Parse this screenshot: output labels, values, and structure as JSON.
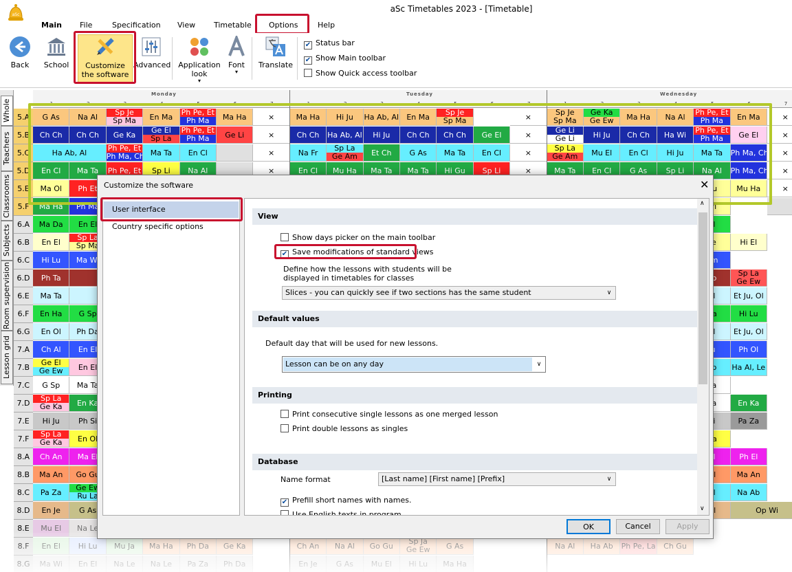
{
  "app": {
    "title": "aSc Timetables 2023 - [Timetable]",
    "logo_text": "aSc"
  },
  "menu": [
    "Main",
    "File",
    "Specification",
    "View",
    "Timetable",
    "Options",
    "Help"
  ],
  "ribbon": {
    "buttons": [
      {
        "label": "Back",
        "icon": "back-arrow-icon"
      },
      {
        "label": "School",
        "icon": "school-icon"
      },
      {
        "label": "Customize the software",
        "icon": "pencil-ruler-icon"
      },
      {
        "label": "Advanced",
        "icon": "sliders-icon"
      },
      {
        "label": "Application look",
        "icon": "palette-icon"
      },
      {
        "label": "Font",
        "icon": "font-a-icon"
      },
      {
        "label": "Translate",
        "icon": "translate-icon"
      }
    ],
    "checks": [
      {
        "label": "Status bar",
        "checked": true
      },
      {
        "label": "Show Main toolbar",
        "checked": true
      },
      {
        "label": "Show Quick access toolbar",
        "checked": false
      }
    ]
  },
  "side_tabs": [
    "Whole",
    "Teachers",
    "Classrooms",
    "Subjects",
    "Room supervision",
    "Lesson grid"
  ],
  "days": [
    "Monday",
    "Tuesday",
    "Wednesday"
  ],
  "periods": [
    "1",
    "2",
    "3",
    "4",
    "5",
    "6",
    "7"
  ],
  "rows": [
    "5.A",
    "5.B",
    "5.C",
    "5.D",
    "5.E",
    "5.F",
    "6.A",
    "6.B",
    "6.C",
    "6.D",
    "6.E",
    "6.F",
    "6.G",
    "7.A",
    "7.B",
    "7.C",
    "7.D",
    "7.E",
    "7.F",
    "8.A",
    "8.B",
    "8.C",
    "8.D",
    "8.E",
    "8.F",
    "8.G"
  ],
  "cells": [
    {
      "r": 0,
      "c": 0,
      "t": "G As",
      "bg": "#fbc77e"
    },
    {
      "r": 0,
      "c": 1,
      "t": "Na Al",
      "bg": "#fbc77e"
    },
    {
      "r": 0,
      "c": 2,
      "t": "Sp Je",
      "t2": "Sp Ma",
      "bg": "#ff2222",
      "bg2": "#ffc8e0"
    },
    {
      "r": 0,
      "c": 3,
      "t": "En Ma",
      "bg": "#fbc77e"
    },
    {
      "r": 0,
      "c": 4,
      "t": "Ph Pe, Et",
      "t2": "Ph Ma",
      "bg": "#ff2222",
      "bg2": "#2233dd"
    },
    {
      "r": 0,
      "c": 5,
      "t": "Ma Ha",
      "bg": "#fbc77e"
    },
    {
      "r": 0,
      "c": 6,
      "t": "×",
      "bg": "#ffffff"
    },
    {
      "r": 0,
      "c": 7,
      "t": "Ma Ha",
      "bg": "#fbc77e"
    },
    {
      "r": 0,
      "c": 8,
      "t": "Hi Ju",
      "bg": "#fbc77e"
    },
    {
      "r": 0,
      "c": 9,
      "t": "Ha Ab, Al",
      "bg": "#fbc77e"
    },
    {
      "r": 0,
      "c": 10,
      "t": "En Ma",
      "bg": "#fbc77e"
    },
    {
      "r": 0,
      "c": 11,
      "t": "Sp Je",
      "t2": "Sp Ma",
      "bg": "#ff2222",
      "bg2": "#fbc77e"
    },
    {
      "r": 0,
      "c": 13,
      "t": "×",
      "bg": "#ffffff"
    },
    {
      "r": 0,
      "c": 14,
      "t": "Sp Je",
      "t2": "Sp Ma",
      "bg": "#fbc77e",
      "bg2": "#fbc77e"
    },
    {
      "r": 0,
      "c": 15,
      "t": "Ge Ka",
      "t2": "Ge Ew",
      "bg": "#22dd44",
      "bg2": "#fbc77e"
    },
    {
      "r": 0,
      "c": 16,
      "t": "Ma Ha",
      "bg": "#fbc77e"
    },
    {
      "r": 0,
      "c": 17,
      "t": "Na Al",
      "bg": "#fbc77e"
    },
    {
      "r": 0,
      "c": 18,
      "t": "Ph Pe, Et",
      "t2": "Ph Ma",
      "bg": "#ff2222",
      "bg2": "#2233dd"
    },
    {
      "r": 0,
      "c": 19,
      "t": "En Ma",
      "bg": "#fbc77e"
    },
    {
      "r": 0,
      "c": 20,
      "t": "×",
      "bg": "#ffffff"
    },
    {
      "r": 1,
      "c": 0,
      "t": "Ch Ch",
      "bg": "#1a2aa8"
    },
    {
      "r": 1,
      "c": 1,
      "t": "Ch Ch",
      "bg": "#1a2aa8"
    },
    {
      "r": 1,
      "c": 2,
      "t": "Ge Ka",
      "bg": "#1a2aa8"
    },
    {
      "r": 1,
      "c": 3,
      "t": "Ge El",
      "t2": "Sp La",
      "bg": "#1a2aa8",
      "bg2": "#ff4444"
    },
    {
      "r": 1,
      "c": 4,
      "t": "Ph Pe, Et",
      "t2": "Ph Ma",
      "bg": "#ff2222",
      "bg2": "#2233dd"
    },
    {
      "r": 1,
      "c": 5,
      "t": "Ge Li",
      "bg": "#ff4444"
    },
    {
      "r": 1,
      "c": 6,
      "t": "×",
      "bg": "#ffffff"
    },
    {
      "r": 1,
      "c": 7,
      "t": "Ch Ch",
      "bg": "#1a2aa8"
    },
    {
      "r": 1,
      "c": 8,
      "t": "Ha Ab, Al",
      "bg": "#1a2aa8"
    },
    {
      "r": 1,
      "c": 9,
      "t": "Hi Ju",
      "bg": "#1a2aa8"
    },
    {
      "r": 1,
      "c": 10,
      "t": "Ch Ch",
      "bg": "#1a2aa8"
    },
    {
      "r": 1,
      "c": 11,
      "t": "Ch Ch",
      "bg": "#1a2aa8"
    },
    {
      "r": 1,
      "c": 12,
      "t": "Ge El",
      "bg": "#22aa44"
    },
    {
      "r": 1,
      "c": 13,
      "t": "×",
      "bg": "#ffffff"
    },
    {
      "r": 1,
      "c": 14,
      "t": "Ge Li",
      "t2": "Ge Li",
      "bg": "#1a2aa8",
      "bg2": "#ffffff"
    },
    {
      "r": 1,
      "c": 15,
      "t": "Hi Ju",
      "bg": "#1a2aa8"
    },
    {
      "r": 1,
      "c": 16,
      "t": "Ch Ch",
      "bg": "#1a2aa8"
    },
    {
      "r": 1,
      "c": 17,
      "t": "Ha Wi",
      "bg": "#1a2aa8"
    },
    {
      "r": 1,
      "c": 18,
      "t": "Ph Pe, Et",
      "t2": "Ph Ma",
      "bg": "#ff2222",
      "bg2": "#2233dd"
    },
    {
      "r": 1,
      "c": 19,
      "t": "Ge El",
      "bg": "#ffd0f0"
    },
    {
      "r": 1,
      "c": 20,
      "t": "×",
      "bg": "#ffffff"
    },
    {
      "r": 2,
      "c": 0,
      "t": "Ha Ab, Al",
      "bg": "#66eeff",
      "w": 2
    },
    {
      "r": 2,
      "c": 2,
      "t": "Ph Pe, Et",
      "t2": "Ph Ma, Ch",
      "bg": "#ff2222",
      "bg2": "#2233dd"
    },
    {
      "r": 2,
      "c": 3,
      "t": "Ma Ta",
      "bg": "#66eeff"
    },
    {
      "r": 2,
      "c": 4,
      "t": "En Cl",
      "bg": "#66eeff"
    },
    {
      "r": 2,
      "c": 5,
      "t": "",
      "bg": "#e0e0e0"
    },
    {
      "r": 2,
      "c": 6,
      "t": "×",
      "bg": "#ffffff"
    },
    {
      "r": 2,
      "c": 7,
      "t": "Na Fr",
      "bg": "#66eeff"
    },
    {
      "r": 2,
      "c": 8,
      "t": "Sp La",
      "t2": "Ge Am",
      "bg": "#66eeff",
      "bg2": "#ff4444"
    },
    {
      "r": 2,
      "c": 9,
      "t": "Et Ch",
      "bg": "#22aa44"
    },
    {
      "r": 2,
      "c": 10,
      "t": "G As",
      "bg": "#66eeff"
    },
    {
      "r": 2,
      "c": 11,
      "t": "Ma Ta",
      "bg": "#66eeff"
    },
    {
      "r": 2,
      "c": 12,
      "t": "En Cl",
      "bg": "#66eeff"
    },
    {
      "r": 2,
      "c": 13,
      "t": "×",
      "bg": "#ffffff"
    },
    {
      "r": 2,
      "c": 14,
      "t": "Sp La",
      "t2": "Ge Am",
      "bg": "#ffff44",
      "bg2": "#ff4444"
    },
    {
      "r": 2,
      "c": 15,
      "t": "Mu El",
      "bg": "#66eeff"
    },
    {
      "r": 2,
      "c": 16,
      "t": "En Cl",
      "bg": "#66eeff"
    },
    {
      "r": 2,
      "c": 17,
      "t": "Hi Ju",
      "bg": "#66eeff"
    },
    {
      "r": 2,
      "c": 18,
      "t": "Ma Ta",
      "bg": "#66eeff"
    },
    {
      "r": 2,
      "c": 19,
      "t": "Ph Ma, Ch",
      "bg": "#2233dd"
    },
    {
      "r": 2,
      "c": 20,
      "t": "×",
      "bg": "#ffffff"
    },
    {
      "r": 3,
      "c": 0,
      "t": "En Cl",
      "bg": "#22aa44"
    },
    {
      "r": 3,
      "c": 1,
      "t": "Ma Ta",
      "bg": "#22aa44"
    },
    {
      "r": 3,
      "c": 2,
      "t": "Ph Pe, Et",
      "bg": "#ff2222"
    },
    {
      "r": 3,
      "c": 3,
      "t": "Sp Li",
      "bg": "#ffff44"
    },
    {
      "r": 3,
      "c": 4,
      "t": "Na Al",
      "bg": "#22aa44"
    },
    {
      "r": 3,
      "c": 5,
      "t": "",
      "bg": "#e0e0e0"
    },
    {
      "r": 3,
      "c": 6,
      "t": "×",
      "bg": "#ffffff"
    },
    {
      "r": 3,
      "c": 7,
      "t": "En Cl",
      "bg": "#22aa44"
    },
    {
      "r": 3,
      "c": 8,
      "t": "Mu Ha",
      "bg": "#22aa44"
    },
    {
      "r": 3,
      "c": 9,
      "t": "Ma Ta",
      "bg": "#22aa44"
    },
    {
      "r": 3,
      "c": 10,
      "t": "Ma Ta",
      "bg": "#22aa44"
    },
    {
      "r": 3,
      "c": 11,
      "t": "Hi Gu",
      "bg": "#22aa44"
    },
    {
      "r": 3,
      "c": 12,
      "t": "Sp Li",
      "bg": "#ff2222"
    },
    {
      "r": 3,
      "c": 13,
      "t": "×",
      "bg": "#ffffff"
    },
    {
      "r": 3,
      "c": 14,
      "t": "Ma Ta",
      "bg": "#22aa44"
    },
    {
      "r": 3,
      "c": 15,
      "t": "En Cl",
      "bg": "#22aa44"
    },
    {
      "r": 3,
      "c": 16,
      "t": "G As",
      "bg": "#22aa44"
    },
    {
      "r": 3,
      "c": 17,
      "t": "Sp Li",
      "bg": "#22aa44"
    },
    {
      "r": 3,
      "c": 18,
      "t": "Na Al",
      "bg": "#22aa44"
    },
    {
      "r": 3,
      "c": 19,
      "t": "Ph Ma, Ch",
      "bg": "#2233dd"
    },
    {
      "r": 3,
      "c": 20,
      "t": "×",
      "bg": "#ffffff"
    },
    {
      "r": 4,
      "c": 0,
      "t": "Ma Ol",
      "bg": "#ffff99"
    },
    {
      "r": 4,
      "c": 1,
      "t": "Ph Et",
      "bg": "#ff2222"
    },
    {
      "r": 4,
      "c": 18,
      "t": "Gu",
      "bg": "#ffff99"
    },
    {
      "r": 4,
      "c": 19,
      "t": "Mu Ha",
      "bg": "#ffff99"
    },
    {
      "r": 4,
      "c": 20,
      "t": "×",
      "bg": "#ffffff"
    },
    {
      "r": 5,
      "c": 0,
      "t": "Ma Ha",
      "bg": "#22aa44"
    },
    {
      "r": 5,
      "c": 1,
      "t": "Ph Ma",
      "bg": "#2233dd"
    },
    {
      "r": 5,
      "c": 18,
      "t": "Wi",
      "bg": "#ffff99"
    },
    {
      "r": 5,
      "c": 20,
      "t": "",
      "bg": "#e0e0e0"
    },
    {
      "r": 6,
      "c": 0,
      "t": "Ma Da",
      "bg": "#22dd44"
    },
    {
      "r": 6,
      "c": 1,
      "t": "En El",
      "bg": "#22dd44"
    },
    {
      "r": 6,
      "c": 18,
      "t": "El",
      "bg": "#22dd44"
    },
    {
      "r": 7,
      "c": 0,
      "t": "En El",
      "bg": "#ffffcc"
    },
    {
      "r": 7,
      "c": 1,
      "t": "Sp La",
      "t2": "Sp Ma",
      "bg": "#ff2222",
      "bg2": "#ffff99"
    },
    {
      "r": 7,
      "c": 18,
      "t": "Le",
      "bg": "#ffff99"
    },
    {
      "r": 7,
      "c": 19,
      "t": "Hi El",
      "bg": "#ffffcc"
    },
    {
      "r": 8,
      "c": 0,
      "t": "Hi Lu",
      "bg": "#3355ff"
    },
    {
      "r": 8,
      "c": 1,
      "t": "Ma Wi",
      "bg": "#3355ff"
    },
    {
      "r": 8,
      "c": 18,
      "t": "Am",
      "bg": "#3355ff"
    },
    {
      "r": 9,
      "c": 0,
      "t": "Ph Ta",
      "bg": "#a0322d"
    },
    {
      "r": 9,
      "c": 1,
      "t": "",
      "bg": "#a0322d"
    },
    {
      "r": 9,
      "c": 18,
      "t": "Sp",
      "bg": "#a0322d"
    },
    {
      "r": 9,
      "c": 19,
      "t": "Sp La",
      "t2": "Ge Ew",
      "bg": "#ff5555",
      "bg2": "#ff5555"
    },
    {
      "r": 10,
      "c": 0,
      "t": "Ma Ta",
      "bg": "#ccf5ff"
    },
    {
      "r": 10,
      "c": 1,
      "t": "",
      "bg": "#ccf5ff"
    },
    {
      "r": 10,
      "c": 18,
      "t": "El",
      "bg": "#ccf5ff"
    },
    {
      "r": 10,
      "c": 19,
      "t": "Et Ju, Ol",
      "bg": "#ccf5ff"
    },
    {
      "r": 11,
      "c": 0,
      "t": "En Ha",
      "bg": "#22dd44"
    },
    {
      "r": 11,
      "c": 1,
      "t": "G Sp",
      "bg": "#22dd44"
    },
    {
      "r": 11,
      "c": 18,
      "t": "Ha",
      "bg": "#22dd44"
    },
    {
      "r": 11,
      "c": 19,
      "t": "Hi Lu",
      "bg": "#22dd44"
    },
    {
      "r": 12,
      "c": 0,
      "t": "En Ol",
      "bg": "#ccf5ff"
    },
    {
      "r": 12,
      "c": 1,
      "t": "Ph Da",
      "bg": "#ccf5ff"
    },
    {
      "r": 12,
      "c": 18,
      "t": "El",
      "bg": "#ccf5ff"
    },
    {
      "r": 12,
      "c": 19,
      "t": "Et Ju, Ol",
      "bg": "#ccf5ff"
    },
    {
      "r": 13,
      "c": 0,
      "t": "Ch Al",
      "bg": "#3355ff"
    },
    {
      "r": 13,
      "c": 1,
      "t": "En El",
      "bg": "#3355ff"
    },
    {
      "r": 13,
      "c": 18,
      "t": "Ju",
      "bg": "#3355ff"
    },
    {
      "r": 13,
      "c": 19,
      "t": "Ph Ol",
      "bg": "#3355ff"
    },
    {
      "r": 14,
      "c": 0,
      "t": "Ge El",
      "t2": "Ge Ew",
      "bg": "#ffff44",
      "bg2": "#66eeff"
    },
    {
      "r": 14,
      "c": 1,
      "t": "En El",
      "bg": "#ffc8e0"
    },
    {
      "r": 14,
      "c": 18,
      "t": "Sp",
      "bg": "#66eeff"
    },
    {
      "r": 14,
      "c": 19,
      "t": "Ha Al, Le",
      "bg": "#66eeff"
    },
    {
      "r": 15,
      "c": 0,
      "t": "G Sp",
      "bg": "#ffffff"
    },
    {
      "r": 15,
      "c": 1,
      "t": "Ma Ta",
      "bg": "#ffffff"
    },
    {
      "r": 15,
      "c": 18,
      "t": "Ka",
      "bg": "#ffffff"
    },
    {
      "r": 16,
      "c": 0,
      "t": "Sp La",
      "t2": "Ge Ka",
      "bg": "#ff2222",
      "bg2": "#ffc8e0"
    },
    {
      "r": 16,
      "c": 1,
      "t": "En Ka",
      "bg": "#22aa44"
    },
    {
      "r": 16,
      "c": 18,
      "t": "Ka",
      "bg": "#ffffff"
    },
    {
      "r": 16,
      "c": 19,
      "t": "En Ka",
      "bg": "#22aa44"
    },
    {
      "r": 17,
      "c": 0,
      "t": "Hi Ju",
      "bg": "#c8c8c8"
    },
    {
      "r": 17,
      "c": 1,
      "t": "Ph Si",
      "bg": "#c8c8c8"
    },
    {
      "r": 17,
      "c": 18,
      "t": "Si",
      "bg": "#c8c8c8"
    },
    {
      "r": 17,
      "c": 19,
      "t": "Pa Za",
      "bg": "#9a9a9a"
    },
    {
      "r": 18,
      "c": 0,
      "t": "Sp La",
      "t2": "Ge Ka",
      "bg": "#ff2222",
      "bg2": "#ffc8e0"
    },
    {
      "r": 18,
      "c": 1,
      "t": "En Ol",
      "bg": "#ffff44"
    },
    {
      "r": 18,
      "c": 18,
      "t": "Ha",
      "bg": "#ffff44"
    },
    {
      "r": 19,
      "c": 0,
      "t": "Ch An",
      "bg": "#ee22ee"
    },
    {
      "r": 19,
      "c": 1,
      "t": "Ma El",
      "bg": "#ee22ee"
    },
    {
      "r": 19,
      "c": 18,
      "t": "El",
      "bg": "#ee22ee"
    },
    {
      "r": 19,
      "c": 19,
      "t": "Ph El",
      "bg": "#ee22ee"
    },
    {
      "r": 20,
      "c": 0,
      "t": "Ma An",
      "bg": "#ff9966"
    },
    {
      "r": 20,
      "c": 1,
      "t": "Go Gu",
      "bg": "#ff9966"
    },
    {
      "r": 20,
      "c": 18,
      "t": "Ol",
      "bg": "#ff9966"
    },
    {
      "r": 20,
      "c": 19,
      "t": "Ma An",
      "bg": "#ff9966"
    },
    {
      "r": 21,
      "c": 0,
      "t": "Pa Za",
      "bg": "#66eeff"
    },
    {
      "r": 21,
      "c": 1,
      "t": "Ge Ew",
      "t2": "Ru La",
      "bg": "#22dd44",
      "bg2": "#66eeff"
    },
    {
      "r": 21,
      "c": 18,
      "t": "Cl",
      "bg": "#66eeff"
    },
    {
      "r": 21,
      "c": 19,
      "t": "Na Ab",
      "bg": "#66eeff"
    },
    {
      "r": 22,
      "c": 0,
      "t": "En Je",
      "bg": "#e6b98a"
    },
    {
      "r": 22,
      "c": 1,
      "t": "G As",
      "bg": "#c6c08a"
    },
    {
      "r": 22,
      "c": 18,
      "t": "Ol",
      "bg": "#e6b98a"
    },
    {
      "r": 22,
      "c": 19,
      "t": "Op Wi",
      "bg": "#c6c08a",
      "w": 2
    },
    {
      "r": 23,
      "c": 0,
      "t": "Mu El",
      "bg": "#d4a0d0"
    },
    {
      "r": 23,
      "c": 1,
      "t": "Na Le",
      "bg": "#d4d0d0"
    },
    {
      "r": 24,
      "c": 0,
      "t": "En El",
      "bg": "#d0f0d0"
    },
    {
      "r": 24,
      "c": 1,
      "t": "Hi Lu",
      "bg": "#d0e0ff"
    },
    {
      "r": 24,
      "c": 2,
      "t": "Mu Ja",
      "bg": "#d0f0d0"
    },
    {
      "r": 24,
      "c": 3,
      "t": "Ma Ha",
      "bg": "#ffd0b0"
    },
    {
      "r": 24,
      "c": 4,
      "t": "Ph Da",
      "bg": "#ffd0b0"
    },
    {
      "r": 24,
      "c": 5,
      "t": "Ge Ka",
      "bg": "#ffd0b0"
    },
    {
      "r": 24,
      "c": 7,
      "t": "Ch An",
      "bg": "#ffd0b0"
    },
    {
      "r": 24,
      "c": 8,
      "t": "Na Al",
      "bg": "#ffd0b0"
    },
    {
      "r": 24,
      "c": 9,
      "t": "Go Gu",
      "bg": "#ffd0b0"
    },
    {
      "r": 24,
      "c": 10,
      "t": "Sp Ja",
      "t2": "Ge Ew",
      "bg": "#ffd0b0",
      "bg2": "#ffd0b0"
    },
    {
      "r": 24,
      "c": 11,
      "t": "G As",
      "bg": "#ffd0b0"
    },
    {
      "r": 24,
      "c": 14,
      "t": "Na Al",
      "bg": "#ffd0b0"
    },
    {
      "r": 24,
      "c": 15,
      "t": "Ha Ab",
      "bg": "#ffd0b0"
    },
    {
      "r": 24,
      "c": 16,
      "t": "Ph Pe, La",
      "bg": "#ffb0b0"
    },
    {
      "r": 24,
      "c": 17,
      "t": "Ch Gu",
      "bg": "#ffd0b0"
    },
    {
      "r": 25,
      "c": 0,
      "t": "Ma Wi",
      "bg": "#e0e0e0"
    },
    {
      "r": 25,
      "c": 1,
      "t": "En El",
      "bg": "#e0e0e0"
    },
    {
      "r": 25,
      "c": 2,
      "t": "Na Le",
      "bg": "#e0e0e0"
    },
    {
      "r": 25,
      "c": 3,
      "t": "Na Le",
      "bg": "#e0e0e0"
    },
    {
      "r": 25,
      "c": 4,
      "t": "Pa Za",
      "bg": "#e0e0e0"
    },
    {
      "r": 25,
      "c": 5,
      "t": "Ph Da",
      "bg": "#e0e0e0"
    },
    {
      "r": 25,
      "c": 7,
      "t": "En Je",
      "bg": "#e0e0e0"
    },
    {
      "r": 25,
      "c": 8,
      "t": "G As",
      "bg": "#e0e0e0"
    },
    {
      "r": 25,
      "c": 9,
      "t": "Mu El",
      "bg": "#e0e0e0"
    },
    {
      "r": 25,
      "c": 10,
      "t": "Hi Lu",
      "bg": "#e0e0e0"
    },
    {
      "r": 25,
      "c": 11,
      "t": "Ma Ha",
      "bg": "#e0e0e0"
    }
  ],
  "dialog": {
    "title": "Customize the software",
    "nav": [
      "User interface",
      "Country specific options"
    ],
    "sections": {
      "view": "View",
      "defaults": "Default values",
      "printing": "Printing",
      "database": "Database"
    },
    "options": {
      "show_days_picker": {
        "label": "Show days picker on the main toolbar",
        "checked": false
      },
      "save_modifications": {
        "label": "Save modifications of standard views",
        "checked": true
      },
      "define_lessons": "Define how the lessons with students will be displayed in timetables for classes",
      "slices_combo": "Slices - you can quickly see if two sections has the same student",
      "default_day_label": "Default day that will be used for new lessons.",
      "default_day_combo": "Lesson can be on any day",
      "print_consecutive": {
        "label": "Print consecutive single lessons as one merged lesson",
        "checked": false
      },
      "print_double": {
        "label": "Print double lessons as singles",
        "checked": false
      },
      "name_format_label": "Name format",
      "name_format_combo": "[Last name] [First name] [Prefix]",
      "prefill_short": {
        "label": "Prefill short names with names.",
        "checked": true
      },
      "use_english": {
        "label": "Use English texts in program",
        "checked": false
      }
    },
    "buttons": {
      "ok": "OK",
      "cancel": "Cancel",
      "apply": "Apply"
    }
  }
}
